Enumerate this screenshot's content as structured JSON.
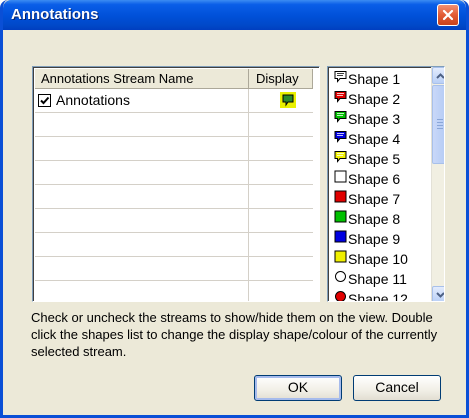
{
  "window": {
    "title": "Annotations",
    "close_icon": "close-x-icon"
  },
  "grid": {
    "headers": [
      "Annotations Stream Name",
      "Display"
    ],
    "rows": [
      {
        "checked": true,
        "name": "Annotations",
        "display_icon": "speech-bubble-icon",
        "display_color": "#e8f000"
      }
    ]
  },
  "shapes": {
    "items": [
      {
        "label": "Shape 1",
        "icon": "speech-bubble-icon",
        "color": "#ffffff"
      },
      {
        "label": "Shape 2",
        "icon": "speech-bubble-icon",
        "color": "#e00000"
      },
      {
        "label": "Shape 3",
        "icon": "speech-bubble-icon",
        "color": "#00c000"
      },
      {
        "label": "Shape 4",
        "icon": "speech-bubble-icon",
        "color": "#0000e0"
      },
      {
        "label": "Shape 5",
        "icon": "speech-bubble-icon",
        "color": "#f0f000"
      },
      {
        "label": "Shape 6",
        "icon": "square-icon",
        "color": "#ffffff"
      },
      {
        "label": "Shape 7",
        "icon": "square-icon",
        "color": "#e00000"
      },
      {
        "label": "Shape 8",
        "icon": "square-icon",
        "color": "#00c000"
      },
      {
        "label": "Shape 9",
        "icon": "square-icon",
        "color": "#0000e0"
      },
      {
        "label": "Shape 10",
        "icon": "square-icon",
        "color": "#f0f000"
      },
      {
        "label": "Shape 11",
        "icon": "circle-icon",
        "color": "#ffffff"
      },
      {
        "label": "Shape 12",
        "icon": "circle-icon",
        "color": "#e00000"
      }
    ]
  },
  "help": {
    "text": "Check or uncheck the streams to show/hide them on the view. Double click the shapes list to change the display shape/colour of the currently selected stream."
  },
  "buttons": {
    "ok": "OK",
    "cancel": "Cancel"
  }
}
